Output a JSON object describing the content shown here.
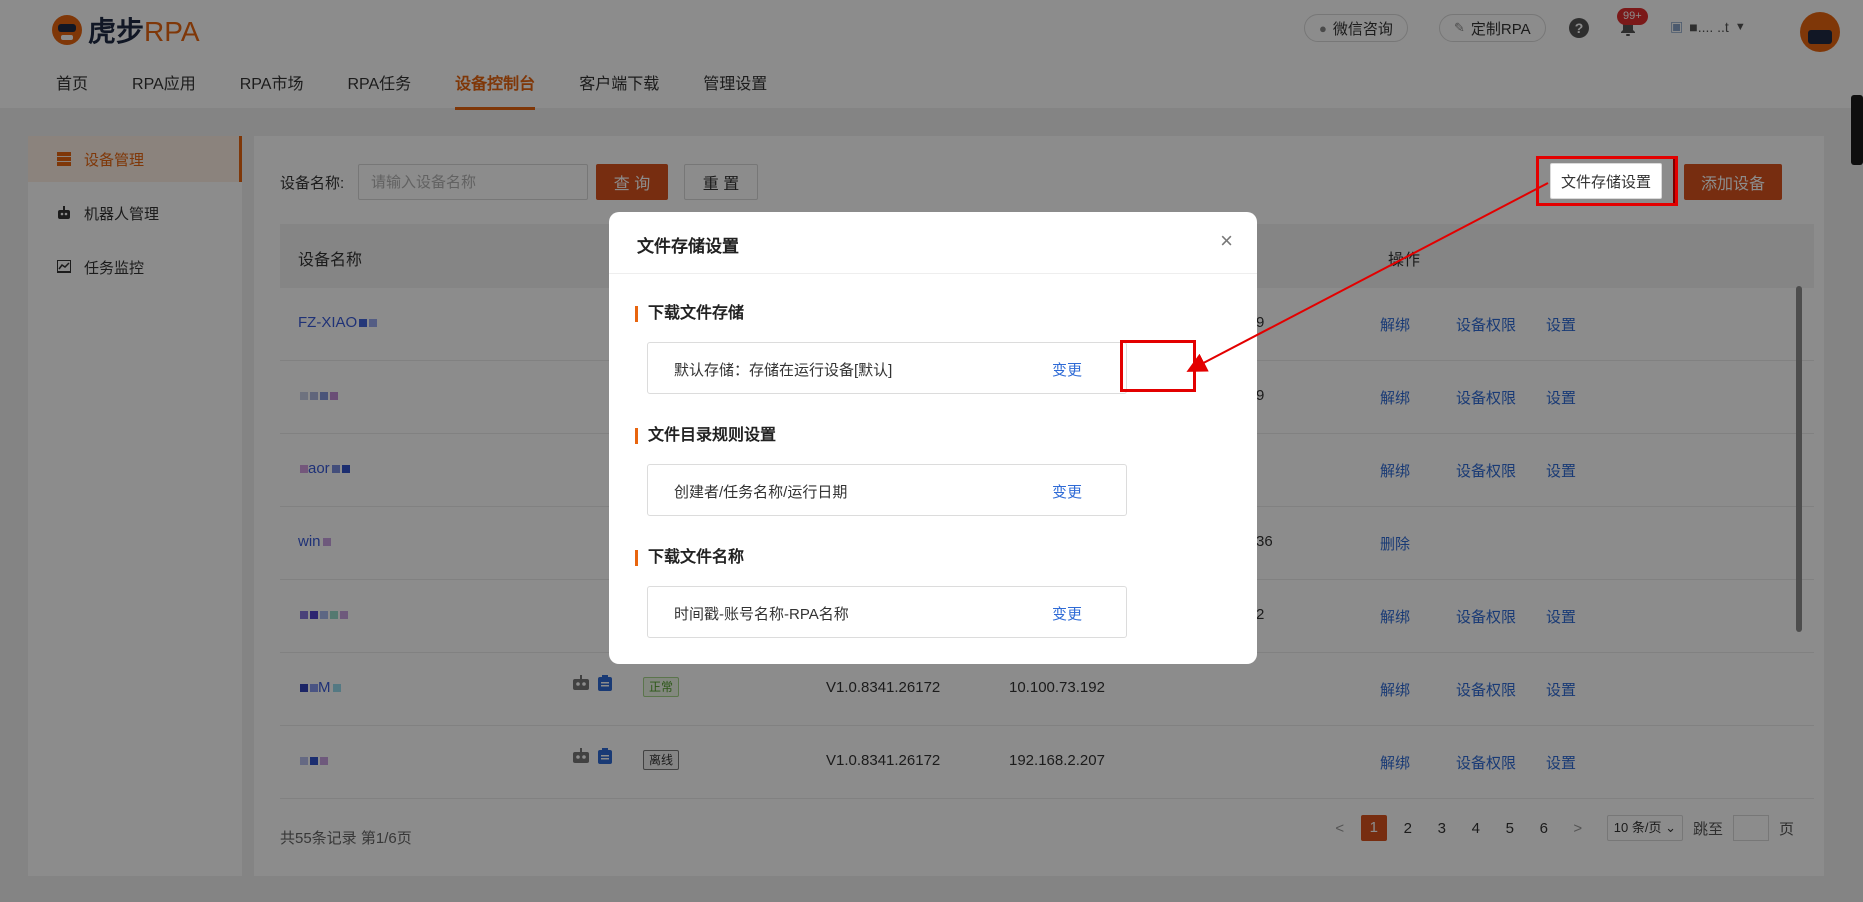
{
  "header": {
    "logo_brand": "虎步",
    "logo_rpa": "RPA",
    "nav": [
      "首页",
      "RPA应用",
      "RPA市场",
      "RPA任务",
      "设备控制台",
      "客户端下载",
      "管理设置"
    ],
    "wechat_label": "微信咨询",
    "custom_rpa_label": "定制RPA",
    "help_glyph": "?",
    "badge": "99+",
    "username": "■.... ..t"
  },
  "sidebar": {
    "items": [
      {
        "label": "设备管理",
        "icon": "server-icon"
      },
      {
        "label": "机器人管理",
        "icon": "robot-icon"
      },
      {
        "label": "任务监控",
        "icon": "chart-icon"
      }
    ]
  },
  "filter": {
    "label": "设备名称:",
    "placeholder": "请输入设备名称",
    "query_label": "查 询",
    "reset_label": "重 置",
    "storage_label": "文件存储设置",
    "add_label": "添加设备"
  },
  "table": {
    "headers": {
      "name": "设备名称",
      "ops": "操作"
    },
    "rows": [
      {
        "name": "FZ-XIAO",
        "ver": "",
        "ip": "9",
        "ops": [
          "解绑",
          "设备权限",
          "设置"
        ]
      },
      {
        "name": "",
        "ver": "",
        "ip": "9",
        "ops": [
          "解绑",
          "设备权限",
          "设置"
        ]
      },
      {
        "name": "aor",
        "ver": "",
        "ip": "",
        "ops": [
          "解绑",
          "设备权限",
          "设置"
        ]
      },
      {
        "name": "win",
        "ver": "",
        "ip": "36",
        "ops": [
          "删除"
        ]
      },
      {
        "name": "",
        "ver": "",
        "ip": "2",
        "ops": [
          "解绑",
          "设备权限",
          "设置"
        ]
      },
      {
        "name": "M",
        "status": "正常",
        "ver": "V1.0.8341.26172",
        "ip": "10.100.73.192",
        "ops": [
          "解绑",
          "设备权限",
          "设置"
        ]
      },
      {
        "name": "",
        "status": "离线",
        "ver": "V1.0.8341.26172",
        "ip": "192.168.2.207",
        "ops": [
          "解绑",
          "设备权限",
          "设置"
        ]
      }
    ]
  },
  "footer": {
    "summary": "共55条记录 第1/6页",
    "pages": [
      "1",
      "2",
      "3",
      "4",
      "5",
      "6"
    ],
    "prev": "<",
    "next": ">",
    "page_size": "10 条/页",
    "goto_label": "跳至",
    "page_unit": "页"
  },
  "modal": {
    "title": "文件存储设置",
    "close": "×",
    "sections": [
      {
        "title": "下载文件存储",
        "text": "默认存储：存储在运行设备[默认]",
        "link": "变更"
      },
      {
        "title": "文件目录规则设置",
        "text": "创建者/任务名称/运行日期",
        "link": "变更"
      },
      {
        "title": "下载文件名称",
        "text": "时间戳-账号名称-RPA名称",
        "link": "变更"
      }
    ]
  },
  "colors": {
    "accent": "#e8650f",
    "primary_button": "#d9531e",
    "link": "#2f6bd6",
    "highlight_box": "#e30000"
  }
}
